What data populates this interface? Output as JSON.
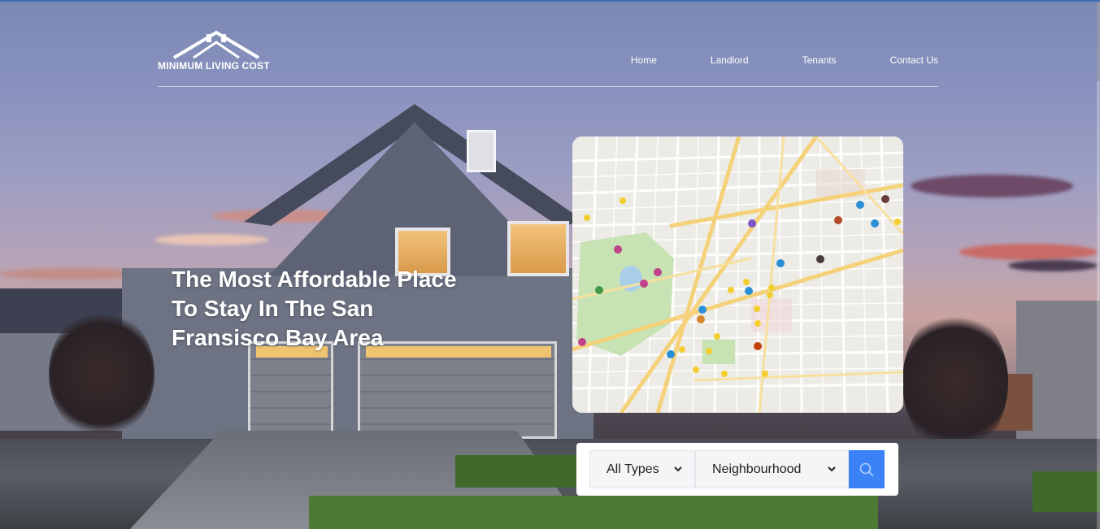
{
  "brand": {
    "logo_text": "MINIMUM LIVING COST",
    "accent_color": "#3b82f6"
  },
  "nav": {
    "items": [
      {
        "label": "Home"
      },
      {
        "label": "Landlord"
      },
      {
        "label": "Tenants"
      },
      {
        "label": "Contact Us"
      }
    ]
  },
  "hero": {
    "headline": "The Most Affordable Place To Stay In The San Fransisco Bay Area"
  },
  "map": {
    "icon": "city-map-image"
  },
  "search": {
    "type_select": {
      "selected": "All Types"
    },
    "neighbourhood_select": {
      "selected": "Neighbourhood"
    },
    "button_icon": "search-icon"
  }
}
